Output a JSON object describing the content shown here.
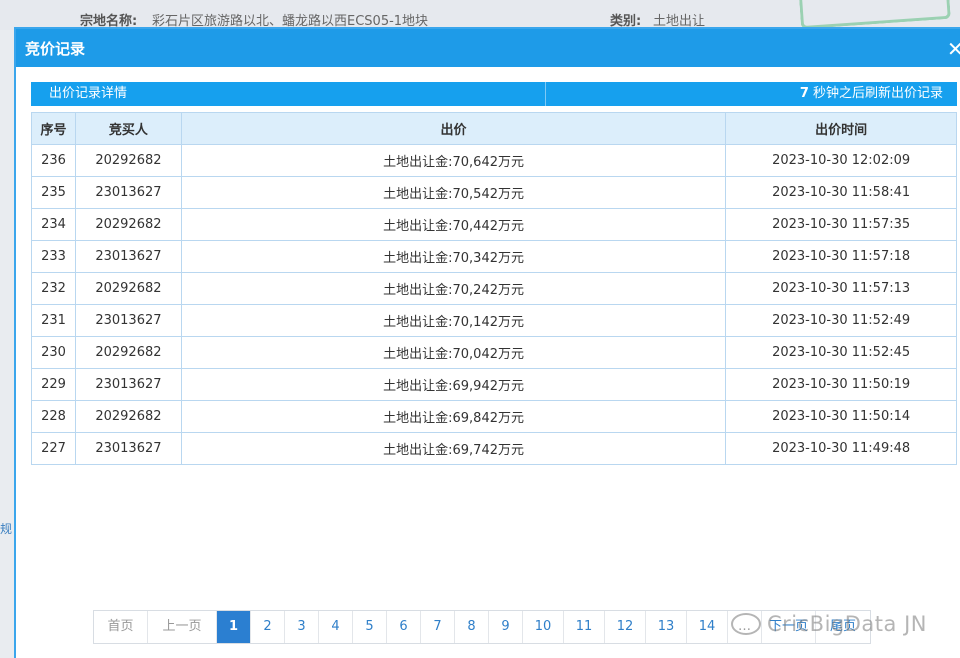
{
  "background": {
    "parcel_label": "宗地名称:",
    "parcel_value": "彩石片区旅游路以北、蟠龙路以西ECS05-1地块",
    "type_label": "类别:",
    "type_value": "土地出让",
    "side_text": "规"
  },
  "modal": {
    "title": "竞价记录",
    "info_left": "出价记录详情",
    "refresh_seconds": "7",
    "refresh_text": " 秒钟之后刷新出价记录"
  },
  "table": {
    "headers": [
      "序号",
      "竞买人",
      "出价",
      "出价时间"
    ],
    "rows": [
      {
        "no": "236",
        "bidder": "20292682",
        "price": "土地出让金:70,642万元",
        "time": "2023-10-30 12:02:09"
      },
      {
        "no": "235",
        "bidder": "23013627",
        "price": "土地出让金:70,542万元",
        "time": "2023-10-30 11:58:41"
      },
      {
        "no": "234",
        "bidder": "20292682",
        "price": "土地出让金:70,442万元",
        "time": "2023-10-30 11:57:35"
      },
      {
        "no": "233",
        "bidder": "23013627",
        "price": "土地出让金:70,342万元",
        "time": "2023-10-30 11:57:18"
      },
      {
        "no": "232",
        "bidder": "20292682",
        "price": "土地出让金:70,242万元",
        "time": "2023-10-30 11:57:13"
      },
      {
        "no": "231",
        "bidder": "23013627",
        "price": "土地出让金:70,142万元",
        "time": "2023-10-30 11:52:49"
      },
      {
        "no": "230",
        "bidder": "20292682",
        "price": "土地出让金:70,042万元",
        "time": "2023-10-30 11:52:45"
      },
      {
        "no": "229",
        "bidder": "23013627",
        "price": "土地出让金:69,942万元",
        "time": "2023-10-30 11:50:19"
      },
      {
        "no": "228",
        "bidder": "20292682",
        "price": "土地出让金:69,842万元",
        "time": "2023-10-30 11:50:14"
      },
      {
        "no": "227",
        "bidder": "23013627",
        "price": "土地出让金:69,742万元",
        "time": "2023-10-30 11:49:48"
      }
    ]
  },
  "pager": {
    "first": "首页",
    "prev": "上一页",
    "pages": [
      "1",
      "2",
      "3",
      "4",
      "5",
      "6",
      "7",
      "8",
      "9",
      "10",
      "11",
      "12",
      "13",
      "14"
    ],
    "current": "1",
    "next": "下一页",
    "last": "尾页"
  },
  "watermark": "CricBigData JN",
  "icons": {
    "close": "close-icon",
    "watermark": "wechat-icon"
  },
  "colors": {
    "accent": "#1e9be8",
    "active_page": "#2b7fd1",
    "header_bg": "#dceefb"
  }
}
